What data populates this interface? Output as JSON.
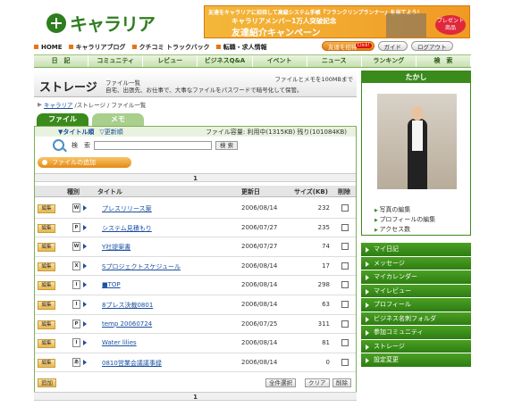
{
  "header": {
    "logo_text": "キャラリア",
    "banner_line1": "友達をキャラリアに招待して高級システム手帳『フランクリンプランナー』を当てよう！",
    "banner_line2": "キャラリアメンバー1万人突破記念",
    "banner_line3": "友達紹介キャンペーン",
    "banner_prize": "プレゼント商品"
  },
  "subnav": [
    "HOME",
    "キャラリアブログ",
    "クチコミ トラックバック",
    "転職・求人情報"
  ],
  "header_buttons": {
    "invite": "友達を招待",
    "guide": "ガイド",
    "logout": "ログアウト"
  },
  "gnav": [
    "日　記",
    "コミュニティ",
    "レビュー",
    "ビジネスQ&A",
    "イベント",
    "ニュース",
    "ランキング",
    "検　索"
  ],
  "storage": {
    "title": "ストレージ",
    "desc1": "ファイル一覧",
    "desc2": "自宅、出張先、お仕事で、大事なファイルをパスワードで暗号化して保管。",
    "capacity_note": "ファイルとメモを100MBまで"
  },
  "breadcrumb": {
    "home": "キャラリア",
    "rest": "/ストレージ / ファイル一覧"
  },
  "tabs": {
    "file": "ファイル",
    "memo": "メモ"
  },
  "sort": {
    "by_title": "▼タイトル順",
    "by_date": "▽更新順",
    "usage": "ファイル容量: 利用中(1315KB) 残り(101084KB)"
  },
  "search": {
    "label": "検　索",
    "button": "検 索"
  },
  "add_file": "ファイルの追加",
  "pager": "1",
  "columns": {
    "kind": "種別",
    "title": "タイトル",
    "date": "更新日",
    "size": "サイズ(KB)",
    "delete": "削除"
  },
  "rows": [
    {
      "icon": "W",
      "title": "プレスリリース案",
      "date": "2006/08/14",
      "size": "232"
    },
    {
      "icon": "P",
      "title": "システム見積もり",
      "date": "2006/07/27",
      "size": "235"
    },
    {
      "icon": "W",
      "title": "Y社提案書",
      "date": "2006/07/27",
      "size": "74"
    },
    {
      "icon": "X",
      "title": "Sプロジェクトスケジュール",
      "date": "2006/08/14",
      "size": "17"
    },
    {
      "icon": "I",
      "title": "■TOP",
      "date": "2006/08/14",
      "size": "298"
    },
    {
      "icon": "I",
      "title": "8プレス決裁0801",
      "date": "2006/08/14",
      "size": "63"
    },
    {
      "icon": "P",
      "title": "temp 20060724",
      "date": "2006/07/25",
      "size": "311"
    },
    {
      "icon": "I",
      "title": "Water lilies",
      "date": "2006/08/14",
      "size": "81"
    },
    {
      "icon": "あ",
      "title": "0810営業会議議事録",
      "date": "2006/08/14",
      "size": "0"
    }
  ],
  "edit_label": "編集",
  "bottom": {
    "add": "追加",
    "select_all": "全件選択",
    "clear": "クリア",
    "delete": "削除"
  },
  "profile": {
    "name": "たかし",
    "links": [
      "写真の編集",
      "プロフィールの編集",
      "アクセス数"
    ]
  },
  "menu": [
    "マイ日記",
    "メッセージ",
    "マイカレンダー",
    "マイレビュー",
    "プロフィール",
    "ビジネス名刺フォルダ",
    "参加コミュニティ",
    "ストレージ",
    "設定変更"
  ]
}
